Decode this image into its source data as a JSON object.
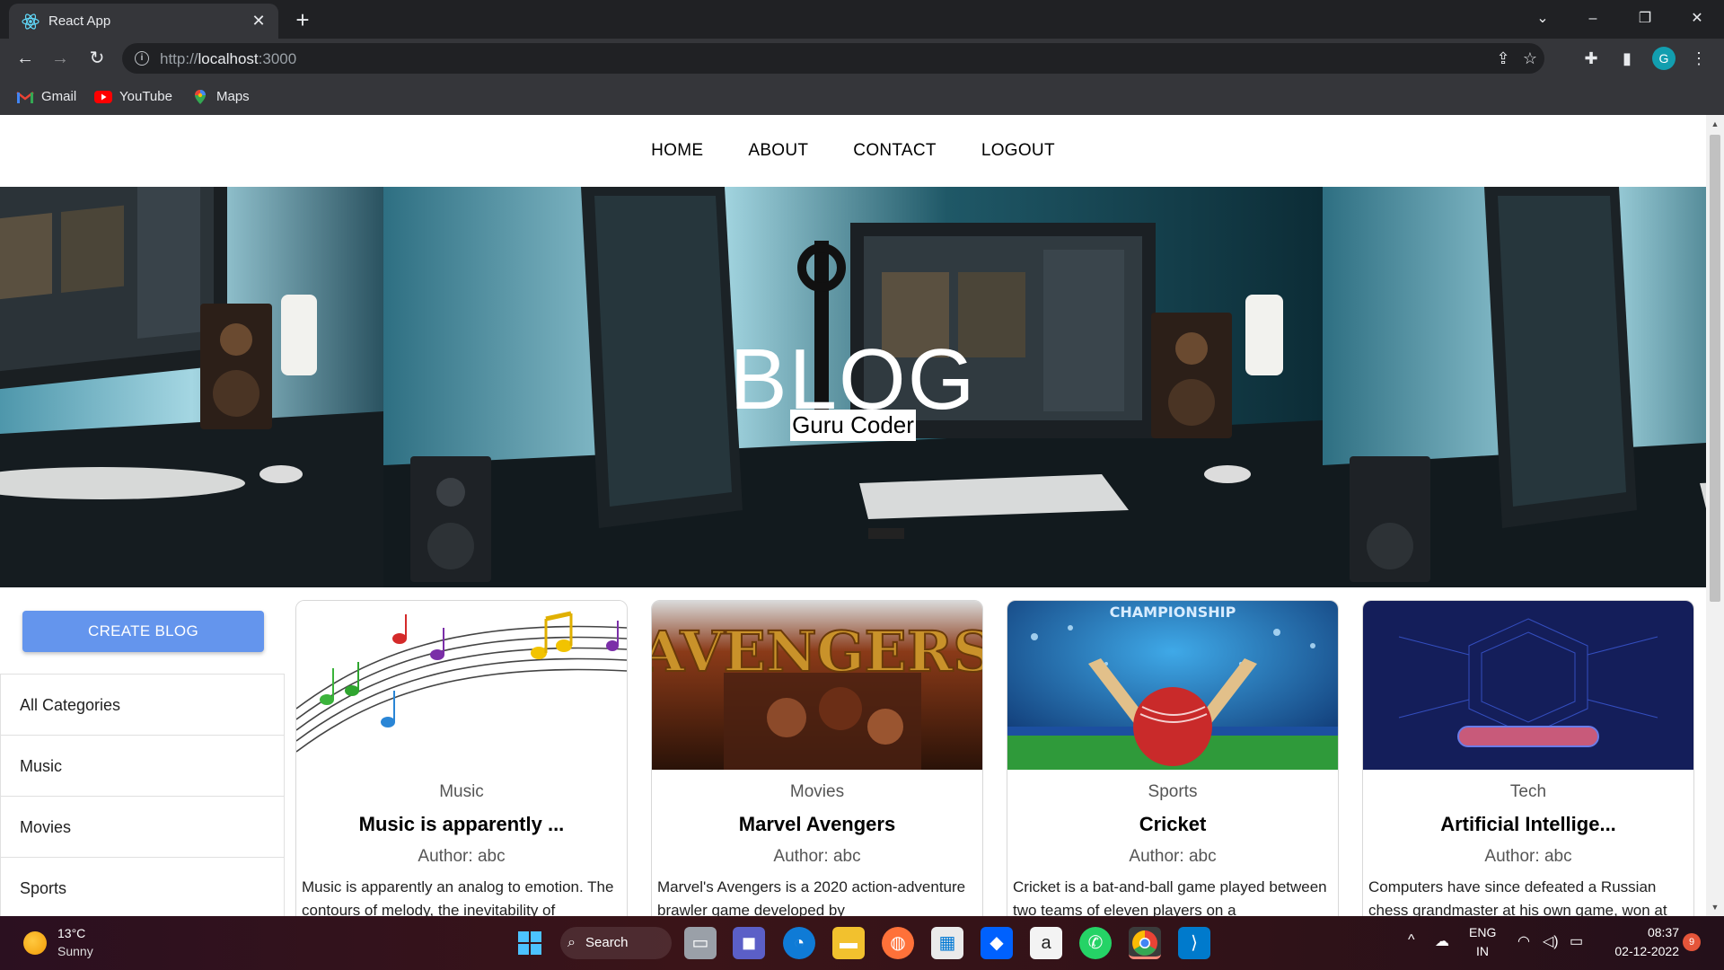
{
  "browser": {
    "tab_title": "React App",
    "url_scheme": "http://",
    "url_host": "localhost",
    "url_port": ":3000",
    "profile_initial": "G",
    "bookmarks": [
      {
        "label": "Gmail",
        "icon": "gmail-icon"
      },
      {
        "label": "YouTube",
        "icon": "youtube-icon"
      },
      {
        "label": "Maps",
        "icon": "maps-icon"
      }
    ]
  },
  "site": {
    "nav": [
      "HOME",
      "ABOUT",
      "CONTACT",
      "LOGOUT"
    ],
    "hero_title": "BLOG",
    "hero_subtitle": "Guru Coder",
    "create_button": "CREATE BLOG",
    "categories": [
      "All Categories",
      "Music",
      "Movies",
      "Sports"
    ],
    "posts": [
      {
        "category": "Music",
        "title": "Music is apparently ...",
        "author": "Author: abc",
        "description": "Music is apparently an analog to emotion. The contours of melody, the inevitability of",
        "image": "music-notes-image"
      },
      {
        "category": "Movies",
        "title": "Marvel Avengers",
        "author": "Author: abc",
        "description": "Marvel's Avengers is a 2020 action-adventure brawler game developed by",
        "image": "avengers-poster-image"
      },
      {
        "category": "Sports",
        "title": "Cricket",
        "author": "Author: abc",
        "description": "Cricket is a bat-and-ball game played between two teams of eleven players on a",
        "image": "cricket-championship-image"
      },
      {
        "category": "Tech",
        "title": "Artificial Intellige...",
        "author": "Author: abc",
        "description": "Computers have since defeated a Russian chess grandmaster at his own game, won at",
        "image": "ai-circuit-image"
      }
    ],
    "image_texts": {
      "cricket_banner": "CHAMPIONSHIP",
      "avengers_logo": "AVENGERS"
    }
  },
  "taskbar": {
    "weather_temp": "13°C",
    "weather_cond": "Sunny",
    "search_label": "Search",
    "lang_top": "ENG",
    "lang_bottom": "IN",
    "time": "08:37",
    "date": "02-12-2022",
    "notification_count": "9"
  },
  "colors": {
    "accent": "#6495ed",
    "chrome_dark": "#202124",
    "chrome_mid": "#35363a"
  }
}
